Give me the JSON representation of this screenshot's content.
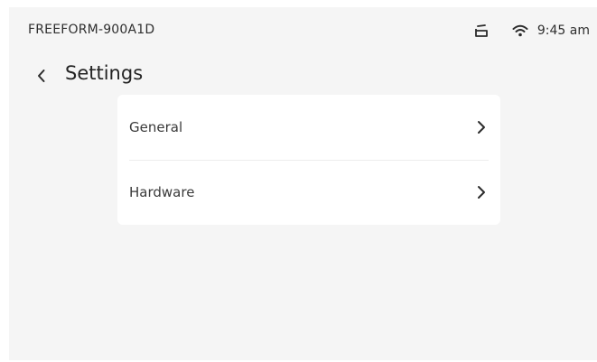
{
  "status_bar": {
    "device_name": "FREEFORM-900A1D",
    "time": "9:45 am",
    "icons": [
      "tray-icon",
      "wifi-icon"
    ]
  },
  "header": {
    "back_icon": "chevron-left-icon",
    "title": "Settings"
  },
  "menu": {
    "items": [
      {
        "label": "General",
        "icon": "chevron-right-icon"
      },
      {
        "label": "Hardware",
        "icon": "chevron-right-icon"
      }
    ]
  },
  "colors": {
    "background": "#f5f5f5",
    "card": "#ffffff",
    "text": "#2a2a2a",
    "divider": "#ececec"
  }
}
